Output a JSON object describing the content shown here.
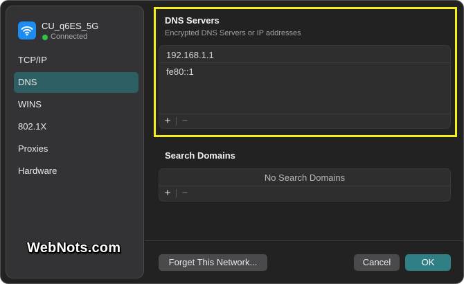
{
  "network": {
    "name": "CU_q6ES_5G",
    "status": "Connected",
    "status_color": "#30c24a",
    "icon": "wifi-icon"
  },
  "sidebar": {
    "items": [
      {
        "label": "TCP/IP",
        "active": false
      },
      {
        "label": "DNS",
        "active": true
      },
      {
        "label": "WINS",
        "active": false
      },
      {
        "label": "802.1X",
        "active": false
      },
      {
        "label": "Proxies",
        "active": false
      },
      {
        "label": "Hardware",
        "active": false
      }
    ]
  },
  "dns": {
    "title": "DNS Servers",
    "subtitle": "Encrypted DNS Servers or IP addresses",
    "servers": [
      "192.168.1.1",
      "fe80::1"
    ],
    "add_label": "+",
    "remove_label": "−"
  },
  "search": {
    "title": "Search Domains",
    "empty_text": "No Search Domains",
    "add_label": "+",
    "remove_label": "−"
  },
  "footer": {
    "forget_label": "Forget This Network...",
    "cancel_label": "Cancel",
    "ok_label": "OK"
  },
  "watermark": "WebNots.com",
  "colors": {
    "accent": "#2f7f84",
    "sidebar_active": "#2c5e63",
    "highlight": "#f5ee1a",
    "wifi_tile": "#1b8cf1"
  }
}
